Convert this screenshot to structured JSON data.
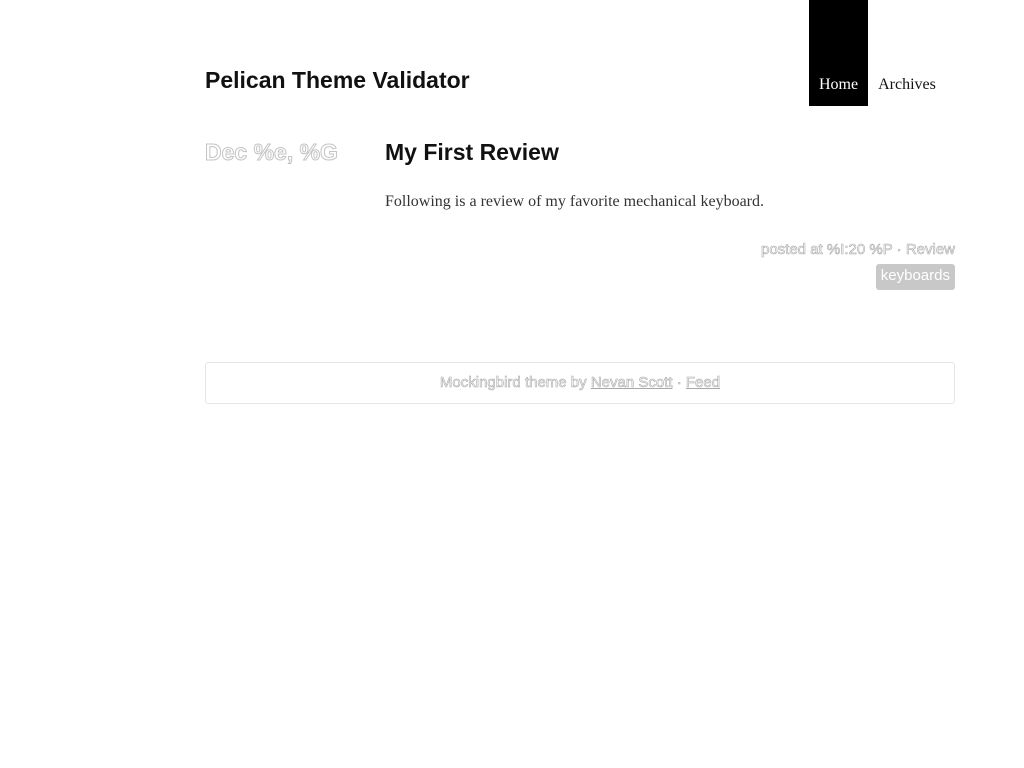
{
  "site": {
    "title": "Pelican Theme Validator"
  },
  "nav": {
    "items": [
      {
        "label": "Home",
        "active": true
      },
      {
        "label": "Archives",
        "active": false
      }
    ]
  },
  "post": {
    "date": "Dec %e, %G",
    "title": "My First Review",
    "summary": "Following is a review of my favorite mechanical keyboard.",
    "meta": {
      "posted_prefix": "posted at %I:20 %P",
      "separator": " · ",
      "category": "Review"
    },
    "tags": [
      "keyboards"
    ]
  },
  "footer": {
    "prefix": "Mockingbird theme by ",
    "author": "Nevan Scott",
    "separator": " · ",
    "feed": "Feed"
  },
  "colors": {
    "nav_active_bg": "#000000",
    "tag_bg": "#c8c8c8",
    "muted_outline": "#a8a8a8"
  }
}
